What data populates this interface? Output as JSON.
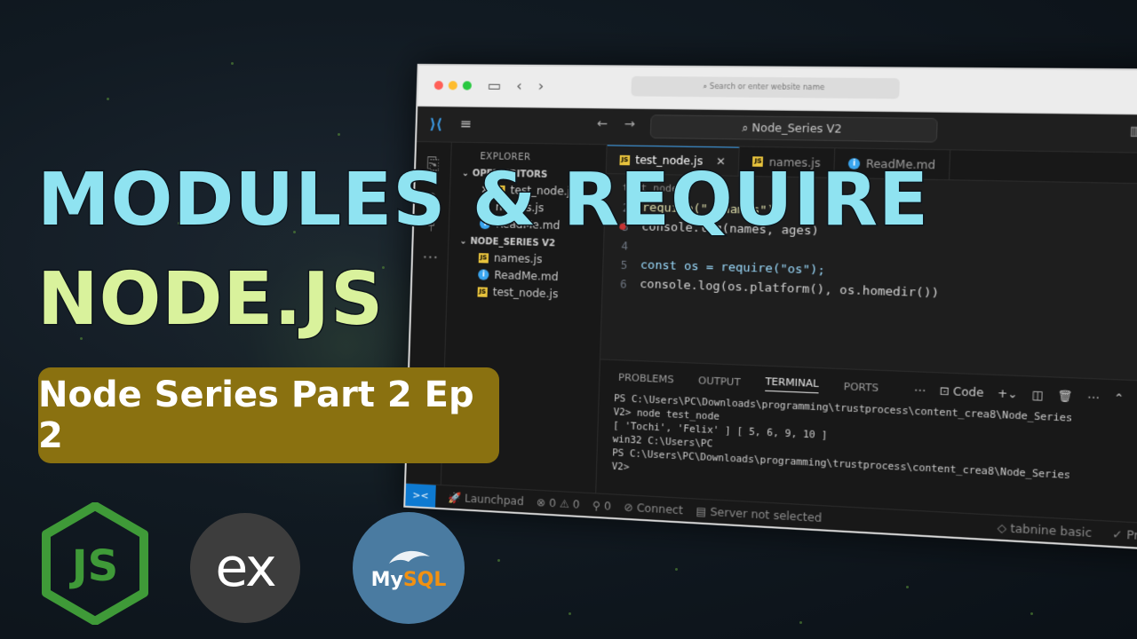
{
  "thumbnail": {
    "title_line1": "MODULES & REQUIRE",
    "title_line2": "NODE.JS",
    "subtitle": "Node Series Part 2 Ep 2",
    "colors": {
      "title1": "#8fe3f1",
      "title2": "#d9f29c",
      "subtitle_bg": "#8a7110"
    }
  },
  "browser": {
    "url_placeholder": "Search or enter website name"
  },
  "vscode": {
    "search": "Node_Series V2",
    "explorer": {
      "header": "EXPLORER",
      "open_editors": "OPEN EDITORS",
      "open_items": [
        "test_node.js",
        "names.js",
        "ReadMe.md"
      ],
      "folder": "NODE_SERIES V2",
      "files": [
        {
          "name": "names.js",
          "type": "js"
        },
        {
          "name": "ReadMe.md",
          "type": "md"
        },
        {
          "name": "test_node.js",
          "type": "js"
        }
      ]
    },
    "tabs": [
      {
        "label": "test_node.js",
        "active": true
      },
      {
        "label": "names.js",
        "active": false
      },
      {
        "label": "ReadMe.md",
        "active": false
      }
    ],
    "breadcrumb": "test_node",
    "code": {
      "line2_tail": "require(\"./names\")",
      "line3": "console.log(names, ages)",
      "line5": "const os = require(\"os\");",
      "line6": "console.log(os.platform(), os.homedir())"
    },
    "panel": {
      "tabs": [
        "PROBLEMS",
        "OUTPUT",
        "TERMINAL",
        "PORTS"
      ],
      "active_tab": "TERMINAL",
      "profile": "Code",
      "terminal_lines": [
        "PS C:\\Users\\PC\\Downloads\\programming\\trustprocess\\content_crea8\\Node_Series",
        "V2> node test_node",
        "[ 'Tochi', 'Felix' ] [ 5, 6, 9, 10 ]",
        "win32 C:\\Users\\PC",
        "PS C:\\Users\\PC\\Downloads\\programming\\trustprocess\\content_crea8\\Node_Series",
        "V2> "
      ]
    },
    "status": {
      "launchpad": "Launchpad",
      "problems": "⊗ 0 ⚠ 0",
      "ports": "0",
      "connect": "Connect",
      "server": "Server not selected",
      "tabnine": "tabnine basic",
      "prettier": "Prettier"
    }
  },
  "logos": {
    "node": "JS",
    "express": "ex",
    "mysql_my": "My",
    "mysql_sql": "SQL"
  }
}
